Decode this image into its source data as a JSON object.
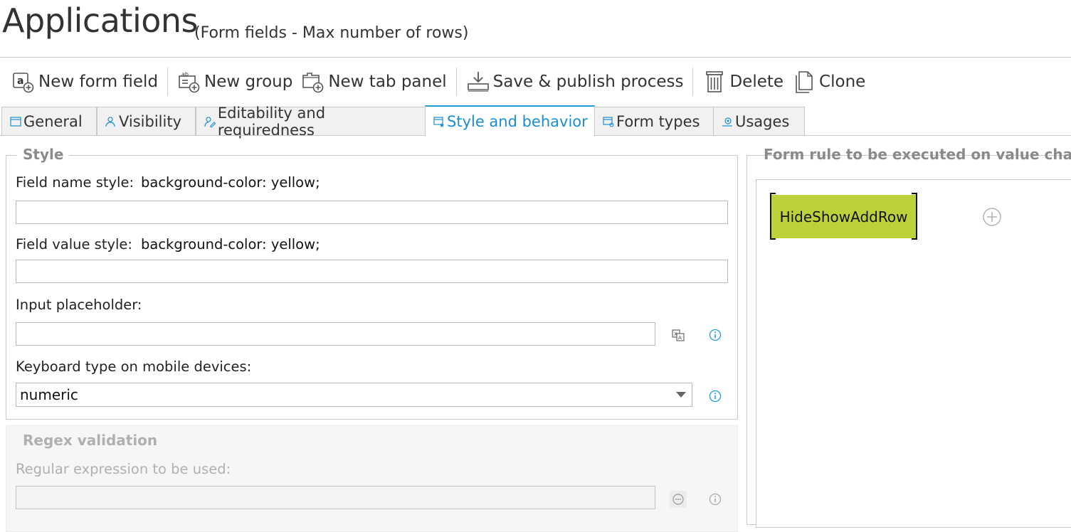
{
  "header": {
    "title": "Applications",
    "subtitle": "(Form fields - Max number of rows)"
  },
  "toolbar": {
    "new_form_field": "New form field",
    "new_group": "New group",
    "new_tab_panel": "New tab panel",
    "save_publish": "Save & publish process",
    "delete": "Delete",
    "clone": "Clone"
  },
  "tabs": {
    "general": "General",
    "visibility": "Visibility",
    "editability": "Editability and requiredness",
    "style": "Style and behavior",
    "form_types": "Form types",
    "usages": "Usages",
    "active": "Style and behavior"
  },
  "style_section": {
    "legend": "Style",
    "field_name_style_label": "Field name style:",
    "field_name_style_value": "background-color: yellow;",
    "field_name_input": "",
    "field_value_style_label": "Field value style:",
    "field_value_style_value": "background-color: yellow;",
    "field_value_input": "",
    "placeholder_label": "Input placeholder:",
    "placeholder_input": "",
    "keyboard_label": "Keyboard type on mobile devices:",
    "keyboard_value": "numeric"
  },
  "regex_section": {
    "legend": "Regex validation",
    "regex_label": "Regular expression to be used:",
    "regex_input": ""
  },
  "form_rule": {
    "legend": "Form rule to be executed on value change",
    "rule_name": "HideShowAddRow"
  },
  "colors": {
    "accent": "#1a8fd0",
    "rule_chip": "#bdd13b",
    "info_icon": "#1aa0dd"
  },
  "icons": [
    "new-form-field-icon",
    "new-group-icon",
    "new-tab-panel-icon",
    "save-publish-icon",
    "delete-icon",
    "clone-icon",
    "info-icon",
    "translate-icon",
    "ellipsis-icon",
    "add-circle-icon"
  ]
}
